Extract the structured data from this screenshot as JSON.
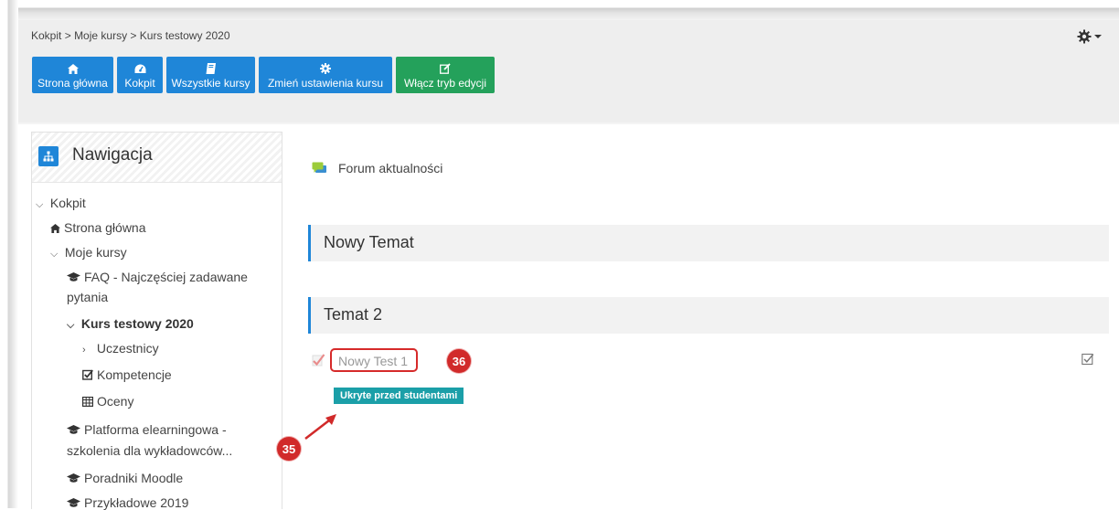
{
  "breadcrumb": {
    "items": [
      "Kokpit",
      "Moje kursy",
      "Kurs testowy 2020"
    ],
    "separator": ">"
  },
  "header": {
    "gear_menu_icon": "gear-icon",
    "buttons": [
      {
        "label": "Strona główna",
        "icon": "home-icon",
        "color": "#1f86d8"
      },
      {
        "label": "Kokpit",
        "icon": "dashboard-icon",
        "color": "#1f86d8"
      },
      {
        "label": "Wszystkie kursy",
        "icon": "book-icon",
        "color": "#1f86d8"
      },
      {
        "label": "Zmień ustawienia kursu",
        "icon": "cog-icon",
        "color": "#1f86d8"
      },
      {
        "label": "Włącz tryb edycji",
        "icon": "edit-icon",
        "color": "#24a15b"
      }
    ]
  },
  "navigation": {
    "title": "Nawigacja",
    "items": [
      {
        "label": "Kokpit",
        "expanded": true
      },
      {
        "label": "Strona główna",
        "icon": "home-icon"
      },
      {
        "label": "Moje kursy",
        "expanded": true
      },
      {
        "label": "FAQ - Najczęściej zadawane",
        "label2": "pytania",
        "icon": "graduation-cap-icon"
      },
      {
        "label": "Kurs testowy 2020",
        "expanded": true,
        "active": true
      },
      {
        "label": "Uczestnicy",
        "expanded": false
      },
      {
        "label": "Kompetencje",
        "icon": "checkbox-icon"
      },
      {
        "label": "Oceny",
        "icon": "table-icon"
      },
      {
        "label": "Platforma elearningowa -",
        "label2": "szkolenia dla wykładowców...",
        "icon": "graduation-cap-icon"
      },
      {
        "label": "Poradniki Moodle",
        "icon": "graduation-cap-icon"
      },
      {
        "label": "Przykładowe 2019",
        "icon": "graduation-cap-icon"
      }
    ]
  },
  "main": {
    "forum": {
      "label": "Forum aktualności",
      "icon": "forum-icon"
    },
    "sections": [
      {
        "title": "Nowy Temat"
      },
      {
        "title": "Temat 2"
      }
    ],
    "activity": {
      "name": "Nowy Test 1",
      "icon": "quiz-icon",
      "hidden_label": "Ukryte przed studentami",
      "completion_icon": "checkbox-icon"
    },
    "annotations": {
      "marker_a": "36",
      "marker_b": "35",
      "color": "#d12a2a"
    }
  }
}
